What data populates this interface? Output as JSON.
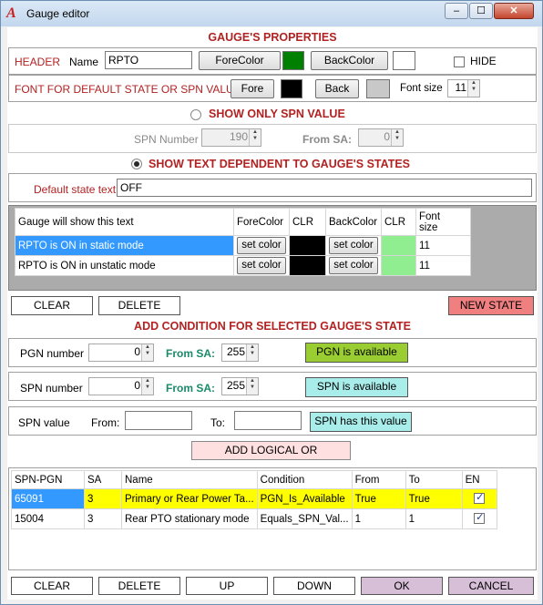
{
  "window": {
    "title": "Gauge editor",
    "minimize": "‒",
    "maximize": "☐",
    "close": "✕"
  },
  "props": {
    "heading": "GAUGE'S PROPERTIES",
    "header_label": "HEADER",
    "name_label": "Name",
    "name_value": "RPTO",
    "forecolor_btn": "ForeColor",
    "backcolor_btn": "BackColor",
    "hide_label": "HIDE",
    "font_label": "FONT FOR DEFAULT STATE OR SPN VALUE",
    "fore_btn": "Fore",
    "back_btn": "Back",
    "fontsize_label": "Font size",
    "fontsize_value": "11",
    "colors": {
      "fore": "#008000",
      "back": "#ffffff",
      "font_fore": "#000000",
      "font_back": "#c8c8c8"
    }
  },
  "spn_only": {
    "label": "SHOW  ONLY SPN VALUE",
    "spn_label": "SPN Number",
    "spn_value": "190",
    "sa_label": "From SA:",
    "sa_value": "0"
  },
  "state_text": {
    "label": "SHOW TEXT DEPENDENT TO GAUGE'S STATES",
    "default_label": "Default state text",
    "default_value": "OFF"
  },
  "states": {
    "columns": [
      "Gauge will show this text",
      "ForeColor",
      "CLR",
      "BackColor",
      "CLR",
      "Font\nsize"
    ],
    "rows": [
      {
        "text": "RPTO is ON in static mode",
        "fore_btn": "set color",
        "fore_clr": "#000000",
        "back_btn": "set color",
        "back_clr": "#90ee90",
        "size": "11",
        "selected": true
      },
      {
        "text": "RPTO is ON in unstatic mode",
        "fore_btn": "set color",
        "fore_clr": "#000000",
        "back_btn": "set color",
        "back_clr": "#90ee90",
        "size": "11",
        "selected": false
      }
    ],
    "clear_btn": "CLEAR",
    "delete_btn": "DELETE",
    "new_state_btn": "NEW STATE"
  },
  "cond": {
    "heading": "ADD CONDITION FOR SELECTED GAUGE'S STATE",
    "pgn_label": "PGN number",
    "pgn_value": "0",
    "from_sa": "From SA:",
    "pgn_sa": "255",
    "pgn_btn": "PGN is available",
    "spn_label": "SPN number",
    "spn_value": "0",
    "spn_sa": "255",
    "spn_btn": "SPN is available",
    "spnval_label": "SPN value",
    "from_label": "From:",
    "to_label": "To:",
    "spnval_btn": "SPN has this value",
    "logical_btn": "ADD LOGICAL OR"
  },
  "conditions": {
    "columns": [
      "SPN-PGN",
      "SA",
      "Name",
      "Condition",
      "From",
      "To",
      "EN"
    ],
    "rows": [
      {
        "spn": "65091",
        "sa": "3",
        "name": "Primary or Rear Power Ta...",
        "cond": "PGN_Is_Available",
        "from": "True",
        "to": "True",
        "en": true,
        "highlight": true
      },
      {
        "spn": "15004",
        "sa": "3",
        "name": "Rear PTO stationary mode",
        "cond": "Equals_SPN_Val...",
        "from": "1",
        "to": "1",
        "en": true,
        "highlight": false
      }
    ]
  },
  "footer": {
    "clear": "CLEAR",
    "delete": "DELETE",
    "up": "UP",
    "down": "DOWN",
    "ok": "OK",
    "cancel": "CANCEL"
  }
}
